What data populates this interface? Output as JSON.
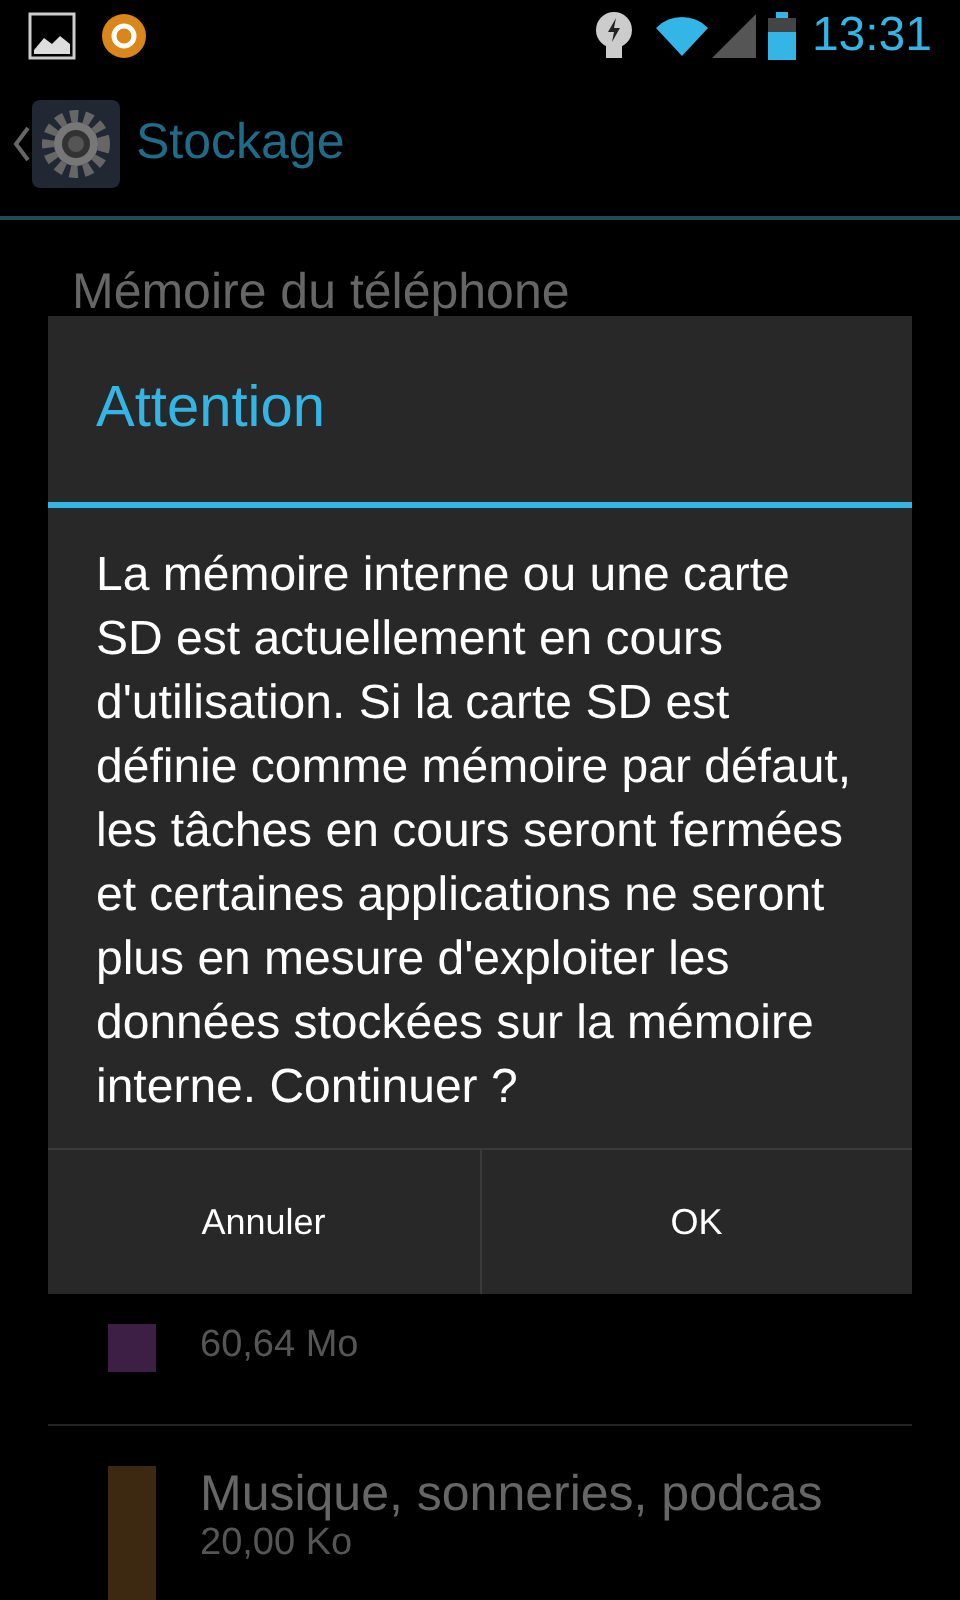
{
  "status_bar": {
    "time": "13:31"
  },
  "action_bar": {
    "title": "Stockage"
  },
  "section_header": "Mémoire du téléphone",
  "storage_items": [
    {
      "size": "60,64 Mo",
      "color": "#3d1f45"
    },
    {
      "label": "Musique, sonneries, podcas",
      "size": "20,00 Ko",
      "color": "#3d2812"
    }
  ],
  "dialog": {
    "title": "Attention",
    "message": "La mémoire interne ou une carte SD est actuellement en cours d'utilisation. Si la carte SD est définie comme mémoire par défaut, les tâches en cours seront fermées et certaines applications ne seront plus en mesure d'exploiter les données stockées sur la mémoire interne. Continuer ?",
    "buttons": [
      "Annuler",
      "OK"
    ]
  }
}
